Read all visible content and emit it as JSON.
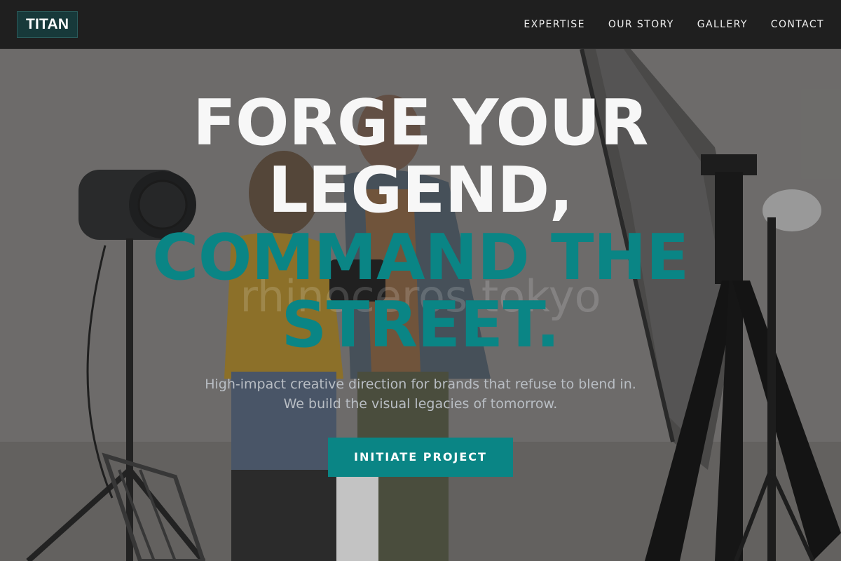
{
  "header": {
    "logo": "TITAN",
    "nav": [
      "EXPERTISE",
      "OUR STORY",
      "GALLERY",
      "CONTACT"
    ]
  },
  "hero": {
    "headline_white_1": "FORGE YOUR",
    "headline_white_2": "LEGEND,",
    "headline_teal_1": "COMMAND THE",
    "headline_teal_2": "STREET.",
    "subtitle_line_1": "High-impact creative direction for brands that refuse to blend in.",
    "subtitle_line_2": "We build the visual legacies of tomorrow.",
    "cta_label": "INITIATE PROJECT",
    "watermark": "rhinoceros tokyo"
  },
  "colors": {
    "header_bg": "#1f1f1f",
    "accent_teal": "#0a8585",
    "logo_bg": "#17393a",
    "headline_white": "#f7f7f7",
    "subtitle": "#b9bec4"
  },
  "icons": [
    "studio-light-icon",
    "tripod-icon",
    "softbox-icon"
  ]
}
